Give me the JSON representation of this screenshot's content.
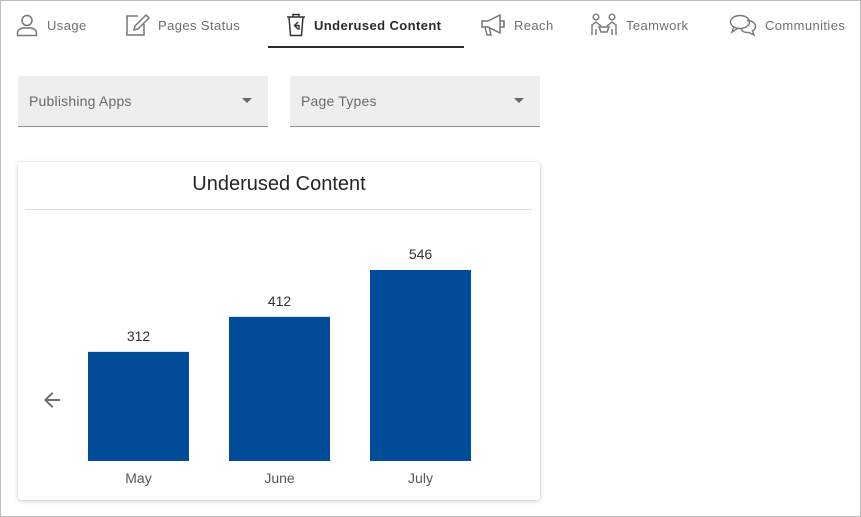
{
  "tabs": [
    {
      "label": "Usage",
      "icon": "user-icon",
      "active": false
    },
    {
      "label": "Pages Status",
      "icon": "edit-icon",
      "active": false
    },
    {
      "label": "Underused Content",
      "icon": "trash-icon",
      "active": true
    },
    {
      "label": "Reach",
      "icon": "megaphone-icon",
      "active": false
    },
    {
      "label": "Teamwork",
      "icon": "teamwork-icon",
      "active": false
    },
    {
      "label": "Communities",
      "icon": "chat-icon",
      "active": false
    }
  ],
  "filters": {
    "publishing_apps_placeholder": "Publishing Apps",
    "page_types_placeholder": "Page Types"
  },
  "card": {
    "title": "Underused Content"
  },
  "colors": {
    "bar": "#004c99",
    "active_tab": "#2b2b2b"
  },
  "chart_data": {
    "type": "bar",
    "categories": [
      "May",
      "June",
      "July"
    ],
    "values": [
      312,
      412,
      546
    ],
    "ylim": [
      0,
      546
    ]
  }
}
